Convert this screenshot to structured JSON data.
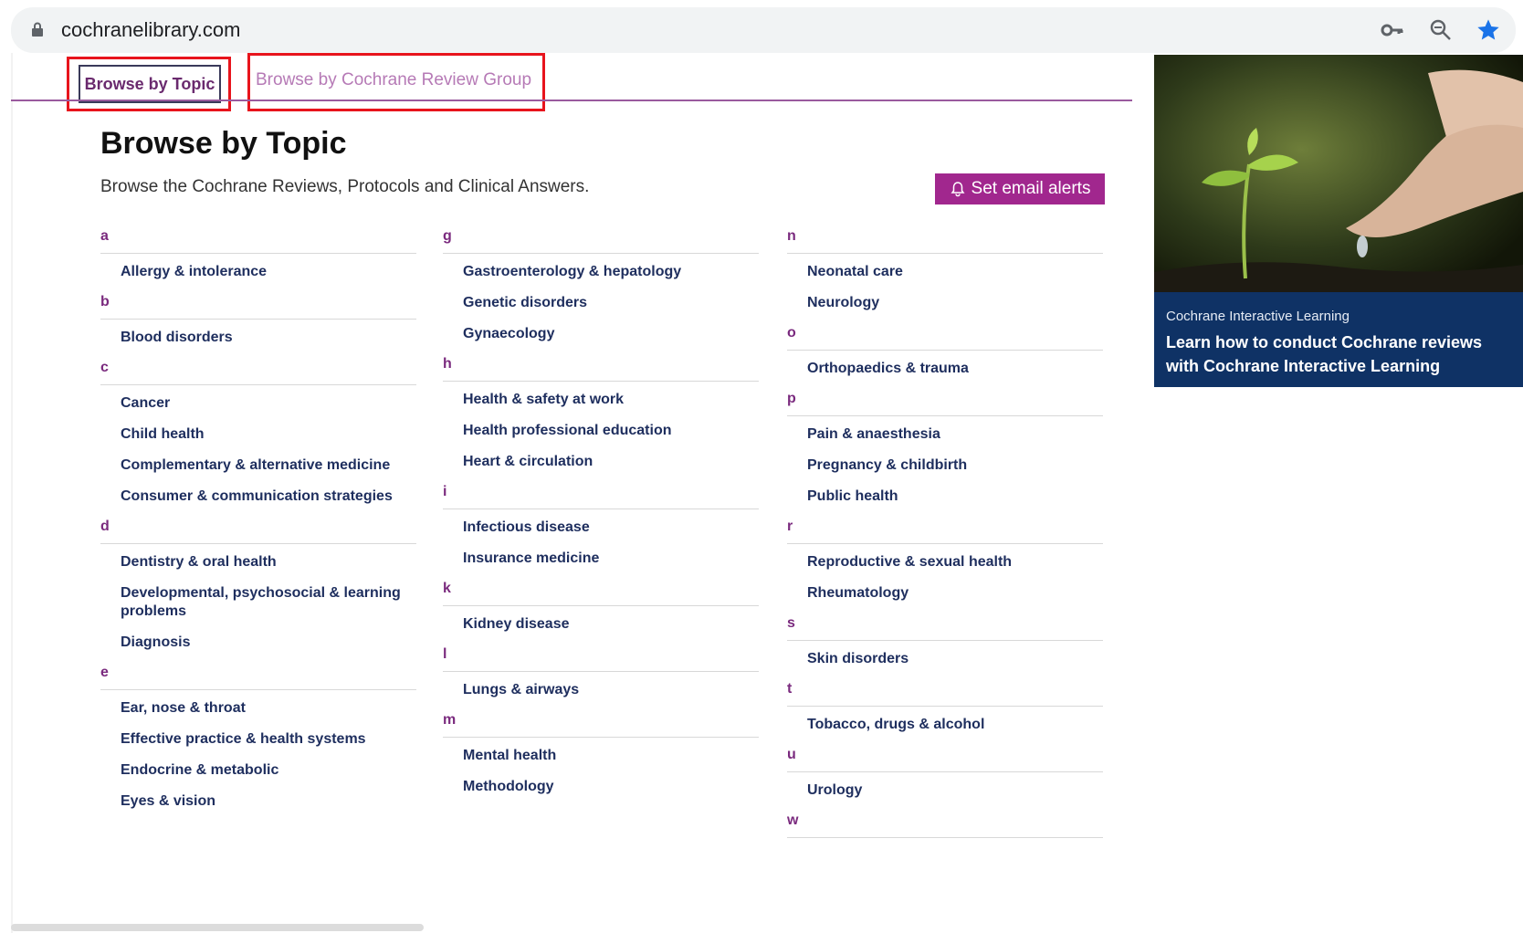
{
  "browser": {
    "url": "cochranelibrary.com"
  },
  "tabs": {
    "topic_label": "Browse by Topic",
    "group_label": "Browse by Cochrane Review Group"
  },
  "header": {
    "title": "Browse by Topic",
    "subtitle": "Browse the Cochrane Reviews, Protocols and Clinical Answers.",
    "alert_button": "Set email alerts"
  },
  "columns": [
    [
      {
        "letter": "a",
        "topics": [
          "Allergy & intolerance"
        ]
      },
      {
        "letter": "b",
        "topics": [
          "Blood disorders"
        ]
      },
      {
        "letter": "c",
        "topics": [
          "Cancer",
          "Child health",
          "Complementary & alternative medicine",
          "Consumer & communication strategies"
        ]
      },
      {
        "letter": "d",
        "topics": [
          "Dentistry & oral health",
          "Developmental, psychosocial & learning problems",
          "Diagnosis"
        ]
      },
      {
        "letter": "e",
        "topics": [
          "Ear, nose & throat",
          "Effective practice & health systems",
          "Endocrine & metabolic",
          "Eyes & vision"
        ]
      }
    ],
    [
      {
        "letter": "g",
        "topics": [
          "Gastroenterology & hepatology",
          "Genetic disorders",
          "Gynaecology"
        ]
      },
      {
        "letter": "h",
        "topics": [
          "Health & safety at work",
          "Health professional education",
          "Heart & circulation"
        ]
      },
      {
        "letter": "i",
        "topics": [
          "Infectious disease",
          "Insurance medicine"
        ]
      },
      {
        "letter": "k",
        "topics": [
          "Kidney disease"
        ]
      },
      {
        "letter": "l",
        "topics": [
          "Lungs & airways"
        ]
      },
      {
        "letter": "m",
        "topics": [
          "Mental health",
          "Methodology"
        ]
      }
    ],
    [
      {
        "letter": "n",
        "topics": [
          "Neonatal care",
          "Neurology"
        ]
      },
      {
        "letter": "o",
        "topics": [
          "Orthopaedics & trauma"
        ]
      },
      {
        "letter": "p",
        "topics": [
          "Pain & anaesthesia",
          "Pregnancy & childbirth",
          "Public health"
        ]
      },
      {
        "letter": "r",
        "topics": [
          "Reproductive & sexual health",
          "Rheumatology"
        ]
      },
      {
        "letter": "s",
        "topics": [
          "Skin disorders"
        ]
      },
      {
        "letter": "t",
        "topics": [
          "Tobacco, drugs & alcohol"
        ]
      },
      {
        "letter": "u",
        "topics": [
          "Urology"
        ]
      },
      {
        "letter": "w",
        "topics": []
      }
    ]
  ],
  "promo": {
    "kicker": "Cochrane Interactive Learning",
    "headline": "Learn how to conduct Cochrane reviews with Cochrane Interactive Learning"
  },
  "colors": {
    "accent": "#a1278e",
    "highlight_box": "#e8141c",
    "link": "#1e2e5e",
    "promo_bg": "#0f3265"
  }
}
